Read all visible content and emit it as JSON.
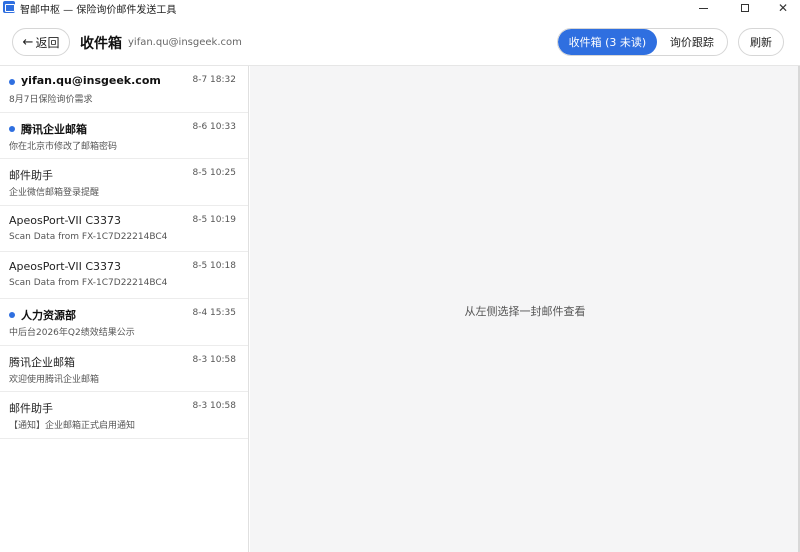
{
  "window": {
    "title": "智邮中枢 — 保险询价邮件发送工具"
  },
  "toolbar": {
    "back_label": "返回",
    "page_title": "收件箱",
    "account": "yifan.qu@insgeek.com",
    "tabs": [
      {
        "label": "收件箱 (3 未读)",
        "active": true
      },
      {
        "label": "询价跟踪",
        "active": false
      }
    ],
    "refresh_label": "刷新"
  },
  "mails": [
    {
      "sender": "yifan.qu@insgeek.com",
      "time": "8-7 18:32",
      "preview": "8月7日保险询价需求",
      "unread": true
    },
    {
      "sender": "腾讯企业邮箱",
      "time": "8-6 10:33",
      "preview": "你在北京市修改了邮箱密码",
      "unread": true
    },
    {
      "sender": "邮件助手",
      "time": "8-5 10:25",
      "preview": "企业微信邮箱登录提醒",
      "unread": false
    },
    {
      "sender": "ApeosPort-VII C3373",
      "time": "8-5 10:19",
      "preview": "Scan Data from FX-1C7D22214BC4",
      "unread": false
    },
    {
      "sender": "ApeosPort-VII C3373",
      "time": "8-5 10:18",
      "preview": "Scan Data from FX-1C7D22214BC4",
      "unread": false
    },
    {
      "sender": "人力资源部",
      "time": "8-4 15:35",
      "preview": "中后台2026年Q2绩效结果公示",
      "unread": true
    },
    {
      "sender": "腾讯企业邮箱",
      "time": "8-3 10:58",
      "preview": "欢迎使用腾讯企业邮箱",
      "unread": false
    },
    {
      "sender": "邮件助手",
      "time": "8-3 10:58",
      "preview": "【通知】企业邮箱正式启用通知",
      "unread": false
    }
  ],
  "reading_pane": {
    "empty_hint": "从左侧选择一封邮件查看"
  },
  "colors": {
    "accent": "#2f6fe0",
    "pane_bg": "#f5f5f6"
  }
}
